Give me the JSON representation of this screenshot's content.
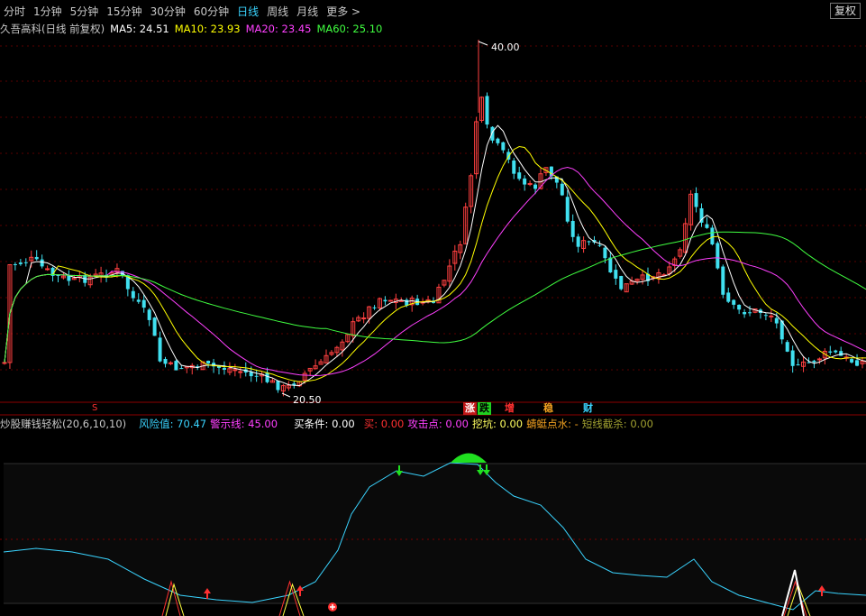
{
  "toolbar": {
    "items": [
      "分时",
      "1分钟",
      "5分钟",
      "15分钟",
      "30分钟",
      "60分钟",
      "日线",
      "周线",
      "月线",
      "更多 >"
    ],
    "active": "日线",
    "fuquan": "复权"
  },
  "main_info": {
    "stock": "久吾高科(日线 前复权)",
    "ma5": "MA5: 24.51",
    "ma10": "MA10: 23.93",
    "ma20": "MA20: 23.45",
    "ma60": "MA60: 25.10",
    "high_label": "40.00",
    "low_label": "20.50",
    "colors": {
      "ma5": "#ffffff",
      "ma10": "#ffff00",
      "ma20": "#ff40ff",
      "ma60": "#40ff40",
      "up": "#ff4040",
      "down": "#40e0f0"
    }
  },
  "signals": {
    "zhang": "涨",
    "die": "跌",
    "zeng": "增",
    "wen": "稳",
    "cai": "财",
    "s_mark": "S"
  },
  "indicator": {
    "name": "炒股赚钱轻松(20,6,10,10)",
    "risk": "风险值: 70.47",
    "warn": "警示线: 45.00",
    "buy_cond": "买条件: 0.00",
    "buy": "买: 0.00",
    "attack": "攻击点: 0.00",
    "dig": "挖坑: 0.00",
    "dragonfly": "蜻蜓点水: -",
    "short_kill": "短线截杀: 0.00"
  }
}
